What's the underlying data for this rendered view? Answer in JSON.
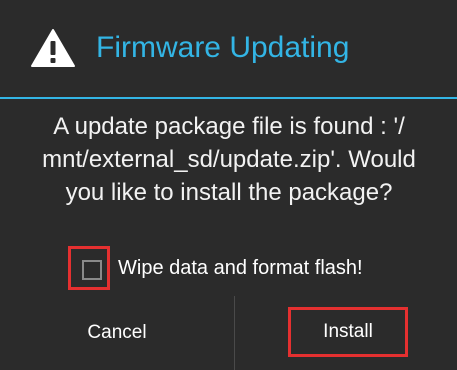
{
  "dialog": {
    "title": "Firmware Updating",
    "title_icon": "warning-triangle-icon",
    "accent_color": "#33b5e5",
    "highlight_color": "#e53030",
    "message_lines": [
      "A update package file is found : '/",
      "mnt/external_sd/update.zip'. Would",
      "you like to install the package?"
    ],
    "checkbox": {
      "label": "Wipe data and format flash!",
      "checked": false
    },
    "buttons": {
      "cancel": "Cancel",
      "install": "Install"
    }
  }
}
